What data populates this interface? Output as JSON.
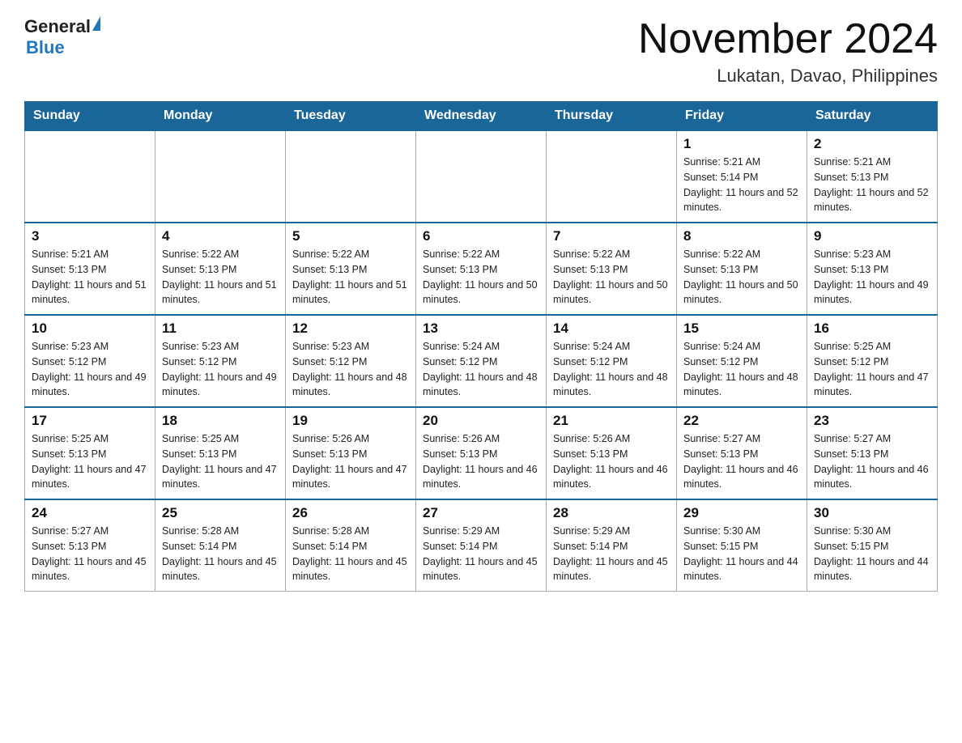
{
  "header": {
    "logo": {
      "text_general": "General",
      "text_blue": "Blue"
    },
    "month_title": "November 2024",
    "location": "Lukatan, Davao, Philippines"
  },
  "weekdays": [
    "Sunday",
    "Monday",
    "Tuesday",
    "Wednesday",
    "Thursday",
    "Friday",
    "Saturday"
  ],
  "weeks": [
    [
      {
        "day": "",
        "info": ""
      },
      {
        "day": "",
        "info": ""
      },
      {
        "day": "",
        "info": ""
      },
      {
        "day": "",
        "info": ""
      },
      {
        "day": "",
        "info": ""
      },
      {
        "day": "1",
        "info": "Sunrise: 5:21 AM\nSunset: 5:14 PM\nDaylight: 11 hours and 52 minutes."
      },
      {
        "day": "2",
        "info": "Sunrise: 5:21 AM\nSunset: 5:13 PM\nDaylight: 11 hours and 52 minutes."
      }
    ],
    [
      {
        "day": "3",
        "info": "Sunrise: 5:21 AM\nSunset: 5:13 PM\nDaylight: 11 hours and 51 minutes."
      },
      {
        "day": "4",
        "info": "Sunrise: 5:22 AM\nSunset: 5:13 PM\nDaylight: 11 hours and 51 minutes."
      },
      {
        "day": "5",
        "info": "Sunrise: 5:22 AM\nSunset: 5:13 PM\nDaylight: 11 hours and 51 minutes."
      },
      {
        "day": "6",
        "info": "Sunrise: 5:22 AM\nSunset: 5:13 PM\nDaylight: 11 hours and 50 minutes."
      },
      {
        "day": "7",
        "info": "Sunrise: 5:22 AM\nSunset: 5:13 PM\nDaylight: 11 hours and 50 minutes."
      },
      {
        "day": "8",
        "info": "Sunrise: 5:22 AM\nSunset: 5:13 PM\nDaylight: 11 hours and 50 minutes."
      },
      {
        "day": "9",
        "info": "Sunrise: 5:23 AM\nSunset: 5:13 PM\nDaylight: 11 hours and 49 minutes."
      }
    ],
    [
      {
        "day": "10",
        "info": "Sunrise: 5:23 AM\nSunset: 5:12 PM\nDaylight: 11 hours and 49 minutes."
      },
      {
        "day": "11",
        "info": "Sunrise: 5:23 AM\nSunset: 5:12 PM\nDaylight: 11 hours and 49 minutes."
      },
      {
        "day": "12",
        "info": "Sunrise: 5:23 AM\nSunset: 5:12 PM\nDaylight: 11 hours and 48 minutes."
      },
      {
        "day": "13",
        "info": "Sunrise: 5:24 AM\nSunset: 5:12 PM\nDaylight: 11 hours and 48 minutes."
      },
      {
        "day": "14",
        "info": "Sunrise: 5:24 AM\nSunset: 5:12 PM\nDaylight: 11 hours and 48 minutes."
      },
      {
        "day": "15",
        "info": "Sunrise: 5:24 AM\nSunset: 5:12 PM\nDaylight: 11 hours and 48 minutes."
      },
      {
        "day": "16",
        "info": "Sunrise: 5:25 AM\nSunset: 5:12 PM\nDaylight: 11 hours and 47 minutes."
      }
    ],
    [
      {
        "day": "17",
        "info": "Sunrise: 5:25 AM\nSunset: 5:13 PM\nDaylight: 11 hours and 47 minutes."
      },
      {
        "day": "18",
        "info": "Sunrise: 5:25 AM\nSunset: 5:13 PM\nDaylight: 11 hours and 47 minutes."
      },
      {
        "day": "19",
        "info": "Sunrise: 5:26 AM\nSunset: 5:13 PM\nDaylight: 11 hours and 47 minutes."
      },
      {
        "day": "20",
        "info": "Sunrise: 5:26 AM\nSunset: 5:13 PM\nDaylight: 11 hours and 46 minutes."
      },
      {
        "day": "21",
        "info": "Sunrise: 5:26 AM\nSunset: 5:13 PM\nDaylight: 11 hours and 46 minutes."
      },
      {
        "day": "22",
        "info": "Sunrise: 5:27 AM\nSunset: 5:13 PM\nDaylight: 11 hours and 46 minutes."
      },
      {
        "day": "23",
        "info": "Sunrise: 5:27 AM\nSunset: 5:13 PM\nDaylight: 11 hours and 46 minutes."
      }
    ],
    [
      {
        "day": "24",
        "info": "Sunrise: 5:27 AM\nSunset: 5:13 PM\nDaylight: 11 hours and 45 minutes."
      },
      {
        "day": "25",
        "info": "Sunrise: 5:28 AM\nSunset: 5:14 PM\nDaylight: 11 hours and 45 minutes."
      },
      {
        "day": "26",
        "info": "Sunrise: 5:28 AM\nSunset: 5:14 PM\nDaylight: 11 hours and 45 minutes."
      },
      {
        "day": "27",
        "info": "Sunrise: 5:29 AM\nSunset: 5:14 PM\nDaylight: 11 hours and 45 minutes."
      },
      {
        "day": "28",
        "info": "Sunrise: 5:29 AM\nSunset: 5:14 PM\nDaylight: 11 hours and 45 minutes."
      },
      {
        "day": "29",
        "info": "Sunrise: 5:30 AM\nSunset: 5:15 PM\nDaylight: 11 hours and 44 minutes."
      },
      {
        "day": "30",
        "info": "Sunrise: 5:30 AM\nSunset: 5:15 PM\nDaylight: 11 hours and 44 minutes."
      }
    ]
  ]
}
